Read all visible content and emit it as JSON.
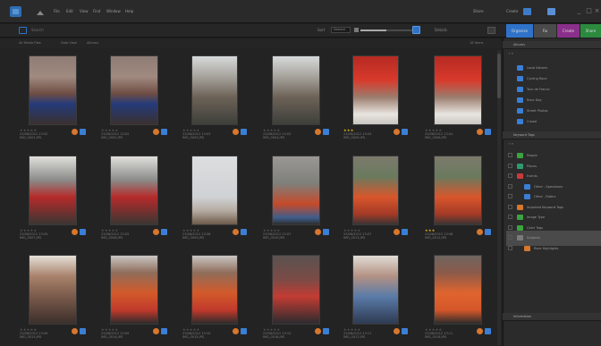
{
  "menubar": {
    "items": [
      "File",
      "Edit",
      "View",
      "Find",
      "Window",
      "Help"
    ],
    "right_items": [
      "Share",
      "Create"
    ],
    "window_buttons": [
      "_",
      "□",
      "×"
    ]
  },
  "toolbar": {
    "search_hint": "Search",
    "sort_label": "Sort",
    "sort_value": "Newest",
    "fit_label": "Details",
    "tabs": [
      {
        "label": "Organize",
        "color": "#2f73c9"
      },
      {
        "label": "Fix",
        "color": "#4a4a4a"
      },
      {
        "label": "Create",
        "color": "#8a2f8a"
      },
      {
        "label": "Share",
        "color": "#2b8a3e"
      }
    ]
  },
  "browser": {
    "sub_items": [
      "All Media Files",
      "Date View",
      "Albums"
    ],
    "count": "18 Items",
    "photos": [
      {
        "caption1": "23/06/2012 13:02",
        "caption2": "IMG_0001.JPG",
        "rating": 0,
        "tone": "crowd-blue"
      },
      {
        "caption1": "23/06/2012 13:02",
        "caption2": "IMG_0002.JPG",
        "rating": 0,
        "tone": "crowd-blue"
      },
      {
        "caption1": "23/06/2012 13:03",
        "caption2": "IMG_0003.JPG",
        "rating": 0,
        "tone": "street"
      },
      {
        "caption1": "23/06/2012 13:03",
        "caption2": "IMG_0004.JPG",
        "rating": 0,
        "tone": "street"
      },
      {
        "caption1": "23/06/2012 13:04",
        "caption2": "IMG_0005.JPG",
        "rating": 3,
        "tone": "red-banner"
      },
      {
        "caption1": "23/06/2012 13:04",
        "caption2": "IMG_0006.JPG",
        "rating": 0,
        "tone": "red-banner"
      },
      {
        "caption1": "23/06/2012 13:05",
        "caption2": "IMG_0007.JPG",
        "rating": 0,
        "tone": "flag-red"
      },
      {
        "caption1": "23/06/2012 13:05",
        "caption2": "IMG_0008.JPG",
        "rating": 0,
        "tone": "flag-red"
      },
      {
        "caption1": "23/06/2012 13:06",
        "caption2": "IMG_0009.JPG",
        "rating": 0,
        "tone": "sky-flag"
      },
      {
        "caption1": "23/06/2012 13:07",
        "caption2": "IMG_0010.JPG",
        "rating": 0,
        "tone": "riders-grey"
      },
      {
        "caption1": "23/06/2012 13:07",
        "caption2": "IMG_0011.JPG",
        "rating": 0,
        "tone": "riders-orange"
      },
      {
        "caption1": "23/06/2012 13:08",
        "caption2": "IMG_0012.JPG",
        "rating": 3,
        "tone": "riders-orange"
      },
      {
        "caption1": "23/06/2012 13:09",
        "caption2": "IMG_0013.JPG",
        "rating": 0,
        "tone": "crowd-street"
      },
      {
        "caption1": "23/06/2012 13:09",
        "caption2": "IMG_0014.JPG",
        "rating": 0,
        "tone": "cyclist-orange"
      },
      {
        "caption1": "23/06/2012 13:10",
        "caption2": "IMG_0015.JPG",
        "rating": 0,
        "tone": "cyclist-orange"
      },
      {
        "caption1": "23/06/2012 13:10",
        "caption2": "IMG_0016.JPG",
        "rating": 0,
        "tone": "crowd-dark"
      },
      {
        "caption1": "23/06/2012 13:11",
        "caption2": "IMG_0017.JPG",
        "rating": 0,
        "tone": "crowd-blue2"
      },
      {
        "caption1": "23/06/2012 13:11",
        "caption2": "IMG_0018.JPG",
        "rating": 0,
        "tone": "rider-closeup"
      }
    ]
  },
  "panel": {
    "albums_header": "Albums",
    "albums": [
      {
        "label": "Local Albums",
        "color": "#3a7fd5"
      },
      {
        "label": "Cycling Race",
        "color": "#3a7fd5"
      },
      {
        "label": "Tour de France",
        "color": "#3a7fd5"
      },
      {
        "label": "Race Day",
        "color": "#3a7fd5"
      },
      {
        "label": "Street Photos",
        "color": "#3a7fd5"
      },
      {
        "label": "Crowd",
        "color": "#3a7fd5"
      }
    ],
    "keywords_header": "Keyword Tags",
    "keywords": [
      {
        "label": "People",
        "color": "#3ba340"
      },
      {
        "label": "Places",
        "color": "#2f9a6e"
      },
      {
        "label": "Events",
        "color": "#c93b3b"
      },
      {
        "label": "Other - Spectators",
        "color": "#3a7fd5"
      },
      {
        "label": "Other - Riders",
        "color": "#3a7fd5"
      },
      {
        "label": "Imported Keyword Tags",
        "color": "#d7772d"
      },
      {
        "label": "Image Type",
        "color": "#3ba340"
      },
      {
        "label": "Color Tags",
        "color": "#3ba340"
      },
      {
        "label": "Subjects",
        "color": "#7a7a7a"
      },
      {
        "label": "Race Highlights",
        "color": "#d7772d"
      }
    ],
    "footer_header": "Information"
  }
}
